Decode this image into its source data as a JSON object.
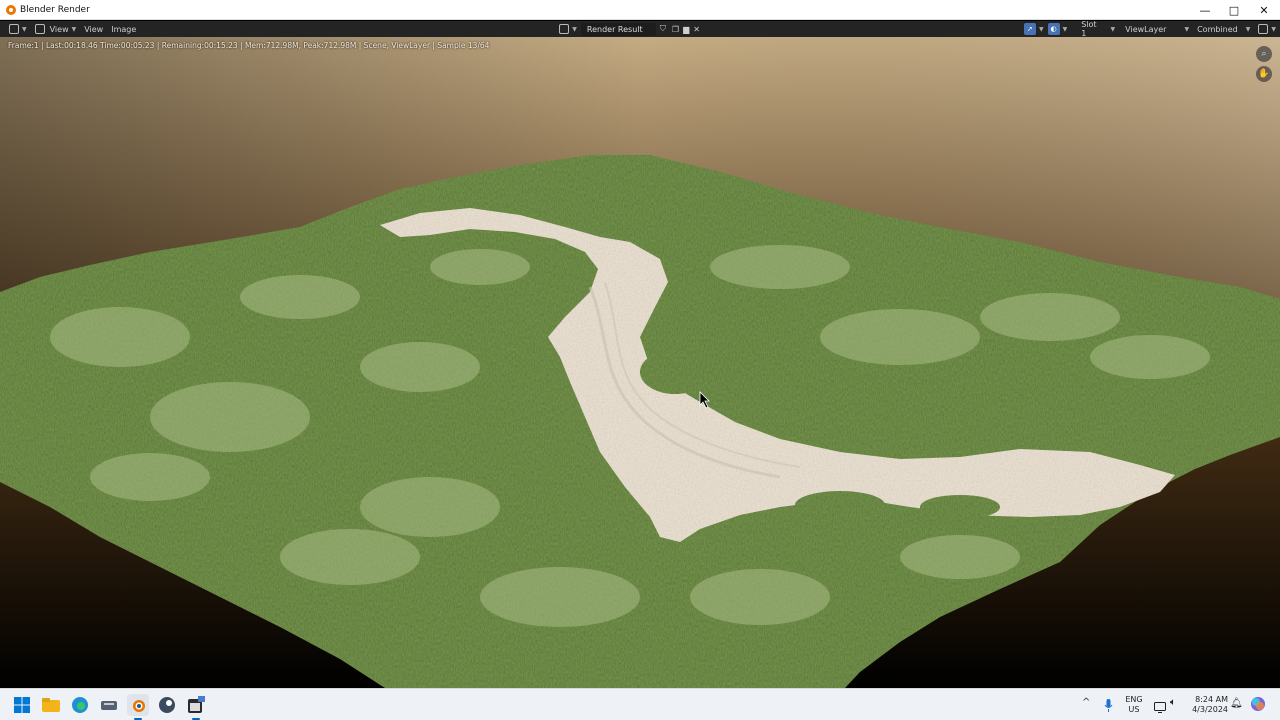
{
  "window": {
    "title": "Blender Render",
    "controls": [
      "—",
      "□",
      "✕"
    ]
  },
  "header": {
    "menus": [
      "View",
      "View",
      "Image"
    ],
    "image_name": "Render Result",
    "slot": "Slot 1",
    "view_layer": "ViewLayer",
    "pass": "Combined"
  },
  "status": {
    "text": "Frame:1 | Last:00:18.46 Time:00:05.23 | Remaining:00:15.23 | Mem:712.98M, Peak:712.98M | Scene, ViewLayer | Sample 13/64"
  },
  "render": {
    "sky_top": "#c4ab83",
    "sky_bottom": "#4b3216",
    "grass": "#6f8f46",
    "grass_light": "#a9bc85",
    "sand": "#e6ddcf"
  },
  "taskbar": {
    "apps": [
      "windows-start-icon",
      "file-explorer-icon",
      "edge-icon",
      "tool-icon",
      "blender-icon",
      "steam-icon",
      "calendar-app-icon"
    ],
    "lang_top": "ENG",
    "lang_bottom": "US",
    "time": "8:24 AM",
    "date": "4/3/2024"
  }
}
